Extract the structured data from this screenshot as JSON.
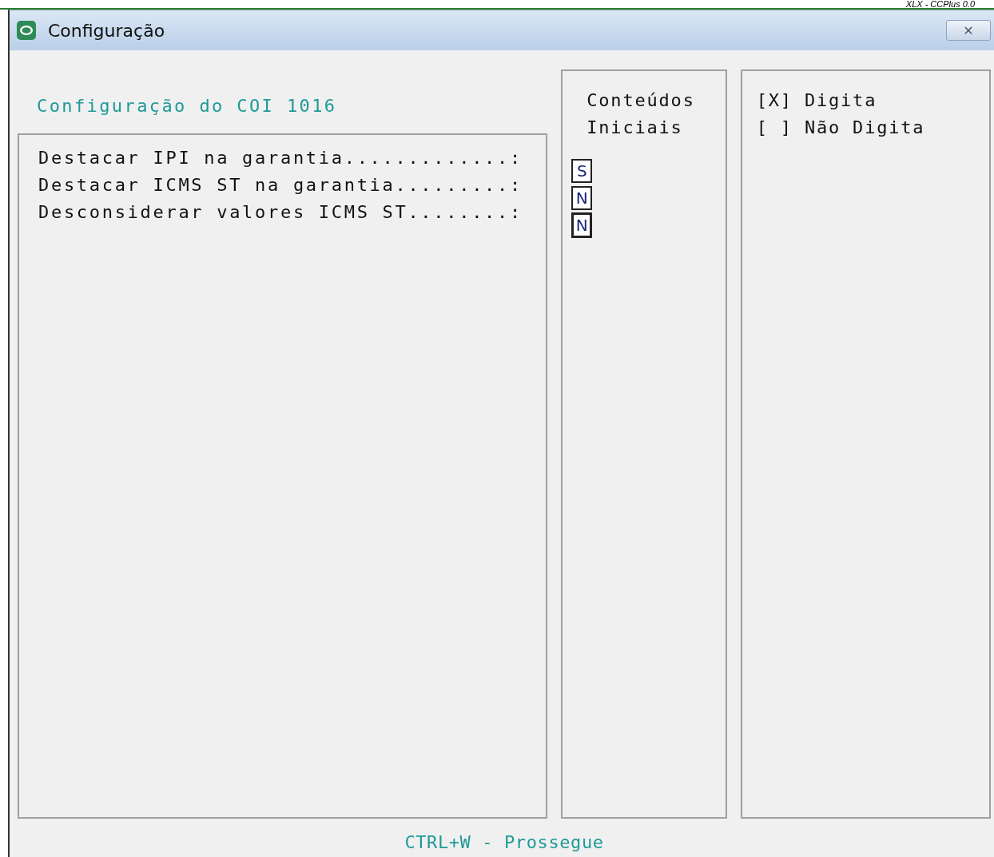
{
  "header": {
    "caption": "XLX - CCPlus 0.0"
  },
  "window": {
    "title": "Configuração",
    "close": "✕"
  },
  "form": {
    "heading": "Configuração do COI 1016",
    "rows": [
      {
        "label": "Destacar IPI na garantia.............:",
        "value": "S",
        "focused": false
      },
      {
        "label": "Destacar ICMS ST na garantia.........:",
        "value": "N",
        "focused": false
      },
      {
        "label": "Desconsiderar valores ICMS ST........:",
        "value": "N",
        "focused": true
      }
    ]
  },
  "initial_panel": {
    "heading": [
      "Conteúdos",
      "Iniciais"
    ]
  },
  "legend": [
    "[X] Digita",
    "[ ] Não Digita"
  ],
  "footer": "CTRL+W - Prossegue"
}
